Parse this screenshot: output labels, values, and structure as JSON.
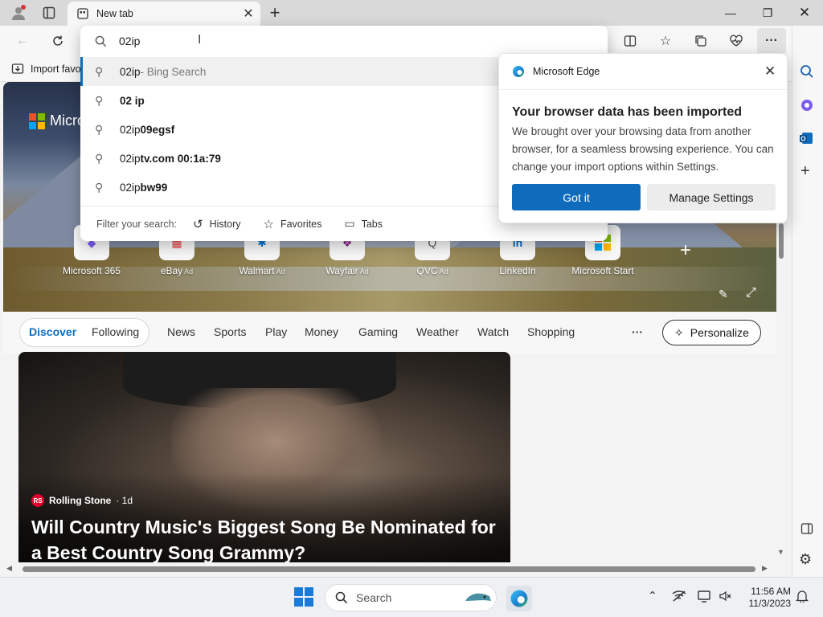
{
  "tab": {
    "title": "New tab"
  },
  "address": {
    "value": "02ip"
  },
  "favorites": {
    "import_label": "Import favo"
  },
  "suggestions": [
    {
      "prefix": "02ip",
      "bold": "",
      "suffix": " - Bing Search"
    },
    {
      "prefix": "",
      "bold": "02 ip",
      "suffix": ""
    },
    {
      "prefix": "02ip",
      "bold": "09egsf",
      "suffix": ""
    },
    {
      "prefix": "02ip",
      "bold": "tv.com 00:1a:79",
      "suffix": ""
    },
    {
      "prefix": "02ip",
      "bold": "bw99",
      "suffix": ""
    }
  ],
  "filter": {
    "label": "Filter your search:",
    "history": "History",
    "favorites": "Favorites",
    "tabs": "Tabs"
  },
  "popup": {
    "app_name": "Microsoft Edge",
    "title": "Your browser data has been imported",
    "body": "We brought over your browsing data from another browser, for a seamless browsing experience. You can change your import options within Settings.",
    "primary": "Got it",
    "secondary": "Manage Settings"
  },
  "hero": {
    "brand": "Micro"
  },
  "quick_links": [
    {
      "label": "Microsoft 365",
      "ad": ""
    },
    {
      "label": "eBay",
      "ad": "Ad"
    },
    {
      "label": "Walmart",
      "ad": "Ad"
    },
    {
      "label": "Wayfair",
      "ad": "Ad"
    },
    {
      "label": "QVC",
      "ad": "Ad"
    },
    {
      "label": "LinkedIn",
      "ad": ""
    },
    {
      "label": "Microsoft Start",
      "ad": ""
    }
  ],
  "feed_nav": {
    "discover": "Discover",
    "following": "Following",
    "items": [
      "News",
      "Sports",
      "Play",
      "Money",
      "Gaming",
      "Weather",
      "Watch",
      "Shopping"
    ],
    "more": "···",
    "personalize": "Personalize"
  },
  "article": {
    "source": "Rolling Stone",
    "age": " · 1d",
    "source_logo": "RS",
    "headline": "Will Country Music's Biggest Song Be Nominated for a Best Country Song Grammy?"
  },
  "taskbar": {
    "search": "Search",
    "time": "11:56 AM",
    "date": "11/3/2023"
  },
  "colors": {
    "accent": "#0f6cbd",
    "selection_bar": "#0f6cbd"
  }
}
